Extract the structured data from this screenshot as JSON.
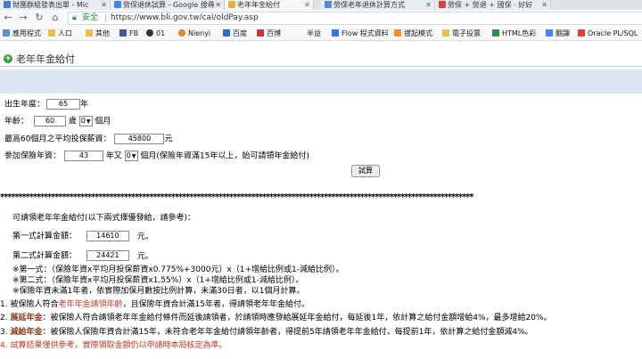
{
  "tabs": [
    {
      "label": "財團群組發表出單 - Mic",
      "active": false,
      "color": "#4a7bd1"
    },
    {
      "label": "勞保退休試算 - Google 搜尋",
      "active": false,
      "color": "#4285f4"
    },
    {
      "label": "老年年金給付",
      "active": true,
      "color": "#e3b341"
    },
    {
      "label": "勞保老年退休計算方式",
      "active": false,
      "color": "#5a8ad6"
    },
    {
      "label": "勞保 + 勞退 + 國保 · 好好",
      "active": false,
      "color": "#d94141"
    }
  ],
  "toolbar": {
    "lock_icon": "lock-icon",
    "secure_label": "安全",
    "url": "https://www.bli.gov.tw/cal/oldPay.asp"
  },
  "bookmarks": [
    {
      "label": "應用程式",
      "color": "#5b8fd9"
    },
    {
      "label": "人口",
      "color": "#e9c046"
    },
    {
      "label": "其他",
      "color": "#e9c046"
    },
    {
      "label": "FB",
      "color": "#3b5998"
    },
    {
      "label": "01",
      "color": "#333333"
    },
    {
      "label": "Nienyi",
      "color": "#e08a2b"
    },
    {
      "label": "百度",
      "color": "#2d6ad9"
    },
    {
      "label": "百博",
      "color": "#cc3333"
    },
    {
      "label": "半益",
      "color": "#888888"
    },
    {
      "label": "Flow 程式資料",
      "color": "#2a7bd4"
    },
    {
      "label": "拔起模式",
      "color": "#ff8c1a"
    },
    {
      "label": "電子投票",
      "color": "#e9c046"
    },
    {
      "label": "HTML色彩",
      "color": "#2d8f47"
    },
    {
      "label": "翻譯",
      "color": "#4285f4"
    },
    {
      "label": "Oracle PL/SQL",
      "color": "#d94141"
    }
  ],
  "page": {
    "title": "老年年金給付",
    "birth_label": "出生年度：",
    "birth_value": "65",
    "birth_unit": "年",
    "age_label": "年齡：",
    "age_value": "60",
    "age_unit1": "歲",
    "age_month": "0",
    "age_unit2": "個月",
    "salary_label": "最高60個月之平均投保薪資：",
    "salary_value": "45800",
    "salary_unit": "元",
    "years_label": "參加保險年資：",
    "years_value": "43",
    "years_unit1": "年又",
    "years_month": "0",
    "years_unit2": "個月(保險年資滿15年以上，始可請領年金給付)",
    "calc_button": "試算"
  },
  "result": {
    "stars": "**********************************************************************************************************************************",
    "intro": "可請領老年年金給付(以下兩式擇優發給，請參考)：",
    "formula1_label": "第一式計算金額：",
    "formula1_value": "14610",
    "formula2_label": "第二式計算金額：",
    "formula2_value": "24421",
    "currency": "元。",
    "note1": "※第一式：（保險年資x平均月投保薪資x0.775%+3000元）x（1+增給比例或1-減給比例）。",
    "note2": "※第二式：（保險年資x平均月投保薪資x1.55%）x（1+增給比例或1-減給比例）。",
    "note3": "※保險年資未滿1年者，依實際加保月數按比例計算，未滿30日者，以1個月計算。",
    "item1_num": "1.",
    "item1_pre": "被保險人符合",
    "item1_red": "老年年金請領年齡",
    "item1_post": "，且保險年資合計滿15年者，得請領老年年金給付。",
    "item2_num": "2.",
    "item2_head": "展延年金：",
    "item2_text": "被保險人符合請領老年年金給付條件而延後請領者，於請領時應發給展延年金給付，每延後1年，依計算之給付金額增給4%，最多增給20%。",
    "item3_num": "3.",
    "item3_head": "減給年金：",
    "item3_text": "被保險人保險年資合計滿15年，未符合老年年金給付請領年齡者，得提前5年請領老年年金給付，每提前1年，依計算之給付金額減4%。",
    "item4_num": "4.",
    "item4_text": "試算結果僅供參考，實際領取金額仍以申請時本局核定為準。"
  }
}
